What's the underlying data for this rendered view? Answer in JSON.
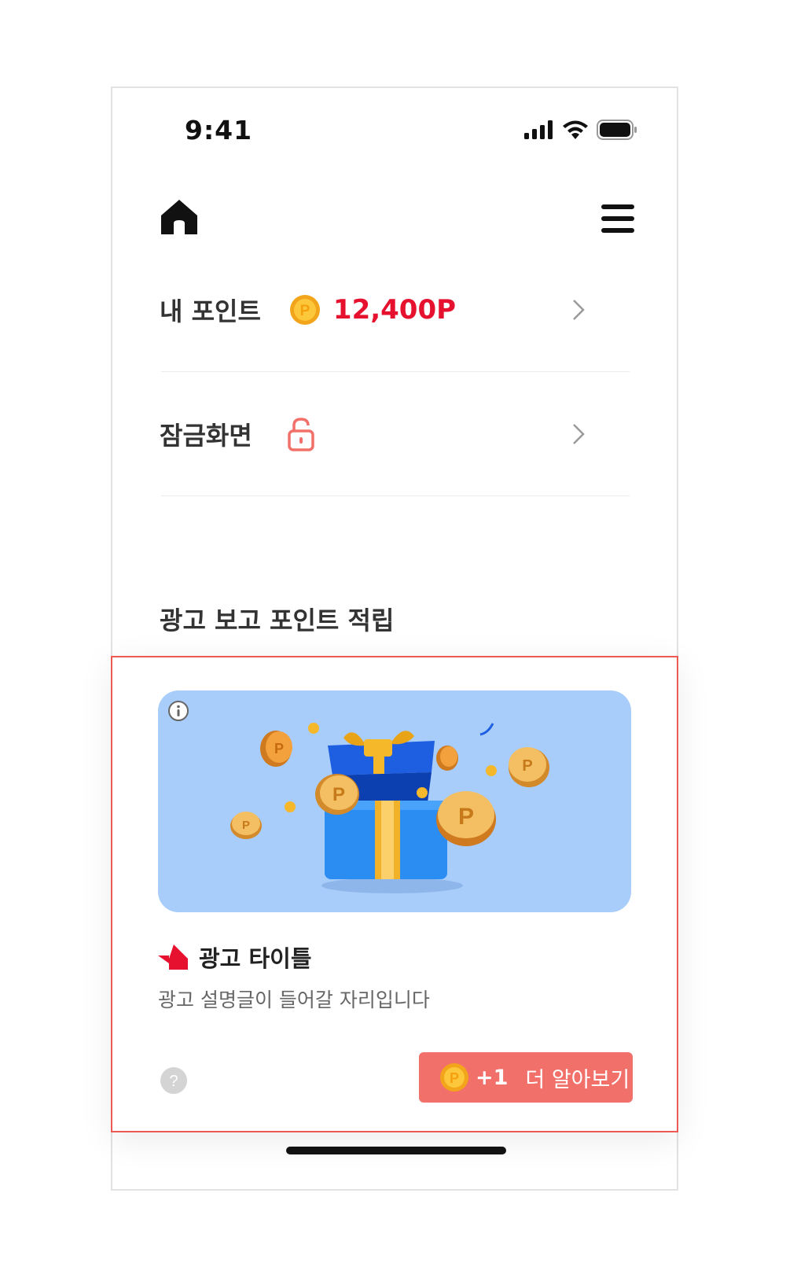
{
  "status_bar": {
    "time": "9:41"
  },
  "points_row": {
    "label": "내 포인트",
    "value": "12,400P"
  },
  "lock_row": {
    "label": "잠금화면"
  },
  "section": {
    "title": "광고 보고 포인트 적립"
  },
  "ad": {
    "title": "광고 타이틀",
    "description": "광고 설명글이 들어갈 자리입니다",
    "cta_points": "+1",
    "cta_label": "더 알아보기"
  },
  "colors": {
    "accent_red": "#e5112f",
    "cta_background": "#f2706a",
    "card_border": "#ee5a52",
    "banner_background": "#a9cdfb",
    "lock_icon": "#f2706a"
  },
  "icons": [
    "home-icon",
    "menu-icon",
    "coin-icon",
    "unlock-icon",
    "chevron-right-icon",
    "info-icon",
    "help-icon",
    "ad-logo-icon",
    "signal-icon",
    "wifi-icon",
    "battery-icon"
  ]
}
